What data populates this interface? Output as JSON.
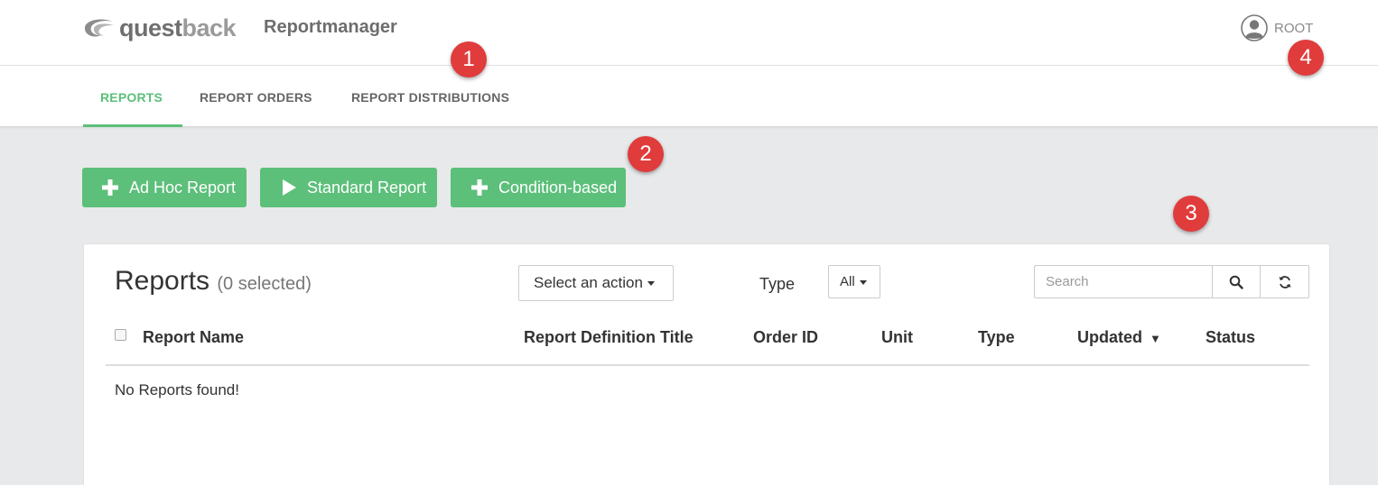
{
  "header": {
    "logo_text_dark": "quest",
    "logo_text_light": "back",
    "app_title": "Reportmanager",
    "user_name": "ROOT",
    "user_icon": "user-avatar-icon"
  },
  "tabs": [
    {
      "label": "REPORTS",
      "active": true
    },
    {
      "label": "REPORT ORDERS",
      "active": false
    },
    {
      "label": "REPORT DISTRIBUTIONS",
      "active": false
    }
  ],
  "badges": [
    "1",
    "2",
    "3",
    "4"
  ],
  "actions": [
    {
      "label": "Ad Hoc Report",
      "icon": "plus-icon"
    },
    {
      "label": "Standard Report",
      "icon": "play-icon"
    },
    {
      "label": "Condition-based",
      "icon": "plus-icon"
    }
  ],
  "panel": {
    "title": "Reports",
    "selected_text": "(0 selected)",
    "action_select": "Select an action",
    "type_label": "Type",
    "type_value": "All",
    "search_placeholder": "Search",
    "columns": [
      "Report Name",
      "Report Definition Title",
      "Order ID",
      "Unit",
      "Type",
      "Updated",
      "Status"
    ],
    "sort_indicator": "▼",
    "empty_message": "No Reports found!"
  },
  "colors": {
    "accent": "#5cbf7a",
    "badge": "#e03c3c",
    "background": "#e8e9ea"
  }
}
